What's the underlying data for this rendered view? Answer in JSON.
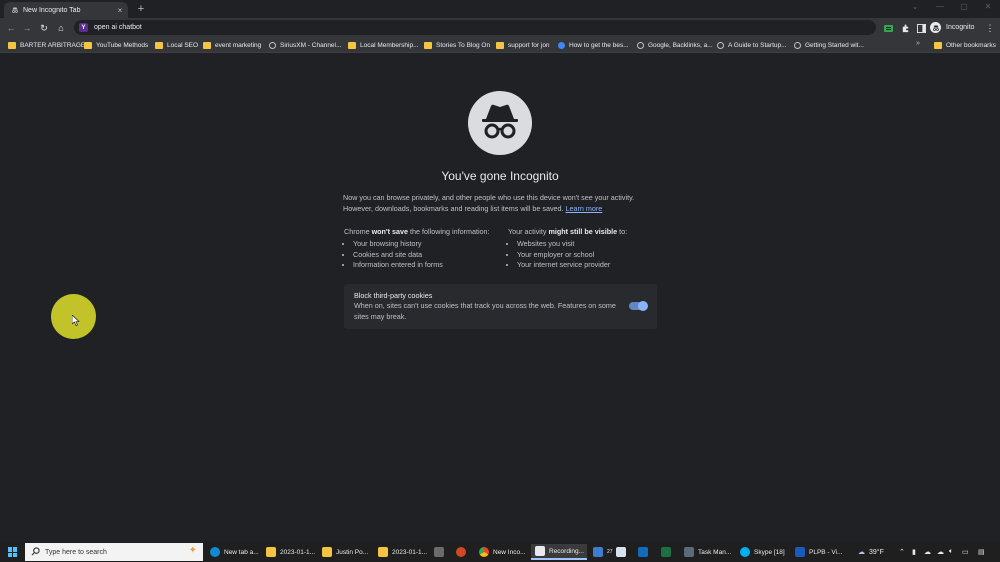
{
  "tab": {
    "title": "New Incognito Tab",
    "close": "×",
    "new_tab": "+"
  },
  "window_controls": {
    "minimize": "—",
    "maximize": "▢",
    "close": "✕",
    "tabsearch": "⌄"
  },
  "toolbar": {
    "back": "←",
    "forward": "→",
    "reload": "↻",
    "home": "⌂",
    "url": "open ai chatbot",
    "site_icon_letter": "Y",
    "menu": "⋮",
    "profile_label": "Incognito"
  },
  "bookmarks": {
    "items": [
      "BARTER ARBITRAGE",
      "YouTube Methods",
      "Local SEO",
      "event marketing",
      "SiriusXM - Channel...",
      "Local Membership...",
      "Stories To Blog On",
      "support for jon",
      "How to get the bes...",
      "Google, Backlinks, a...",
      "A Guide to Startup...",
      "Getting Started wit..."
    ],
    "more": "»",
    "other": "Other bookmarks"
  },
  "incognito": {
    "headline": "You've gone Incognito",
    "intro_1": "Now you can browse privately, and other people who use this device won't see your activity.",
    "intro_2": "However, downloads, bookmarks and reading list items will be saved.",
    "learn_more": "Learn more",
    "left_pre": "Chrome ",
    "left_bold": "won't save",
    "left_post": " the following information:",
    "left_items": [
      "Your browsing history",
      "Cookies and site data",
      "Information entered in forms"
    ],
    "right_pre": "Your activity ",
    "right_bold": "might still be visible",
    "right_post": " to:",
    "right_items": [
      "Websites you visit",
      "Your employer or school",
      "Your internet service provider"
    ],
    "cookie_title": "Block third-party cookies",
    "cookie_desc": "When on, sites can't use cookies that track you across the web. Features on some sites may break.",
    "cookie_toggle": true
  },
  "taskbar": {
    "search_placeholder": "Type here to search",
    "items": [
      "New tab a...",
      "2023-01-1...",
      "Justin Po...",
      "2023-01-1...",
      "New Inco...",
      "Recording...",
      "Task Man...",
      "Skype [18]",
      "PLPB - Vi..."
    ],
    "badge": "27",
    "temperature": "39°F",
    "colors": {
      "accent": "#4cc2ff",
      "folder": "#f4c542",
      "toggle": "#8ab4f8",
      "link": "#8ab4f8"
    }
  }
}
